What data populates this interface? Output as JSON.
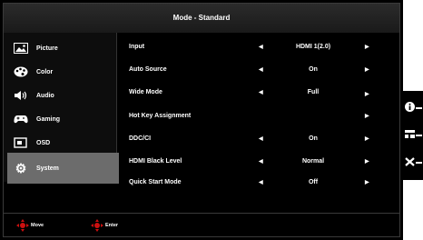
{
  "header": {
    "title": "Mode - Standard"
  },
  "sidebar": {
    "items": [
      {
        "label": "Picture",
        "icon": "picture-icon"
      },
      {
        "label": "Color",
        "icon": "palette-icon"
      },
      {
        "label": "Audio",
        "icon": "speaker-icon"
      },
      {
        "label": "Gaming",
        "icon": "gamepad-icon"
      },
      {
        "label": "OSD",
        "icon": "osd-icon"
      },
      {
        "label": "System",
        "icon": "gear-icon",
        "selected": true
      }
    ]
  },
  "settings": [
    {
      "label": "Input",
      "value": "HDMI 1(2.0)",
      "left_arrow": true,
      "right_arrow": true
    },
    {
      "label": "Auto Source",
      "value": "On",
      "left_arrow": true,
      "right_arrow": true
    },
    {
      "label": "Wide Mode",
      "value": "Full",
      "left_arrow": true,
      "right_arrow": true
    },
    {
      "label": "Hot Key Assignment",
      "value": "",
      "left_arrow": false,
      "right_arrow": true
    },
    {
      "label": "DDC/CI",
      "value": "On",
      "left_arrow": true,
      "right_arrow": true
    },
    {
      "label": "HDMI Black Level",
      "value": "Normal",
      "left_arrow": true,
      "right_arrow": true
    },
    {
      "label": "Quick Start Mode",
      "value": "Off",
      "left_arrow": true,
      "right_arrow": true
    }
  ],
  "footer": {
    "move_label": "Move",
    "enter_label": "Enter"
  },
  "side_keys": [
    {
      "icon": "info-icon"
    },
    {
      "icon": "menu-icon"
    },
    {
      "icon": "close-icon"
    }
  ],
  "colors": {
    "selected_bg": "#6c6c6c",
    "accent_red": "#cc1010",
    "background": "#000000"
  }
}
